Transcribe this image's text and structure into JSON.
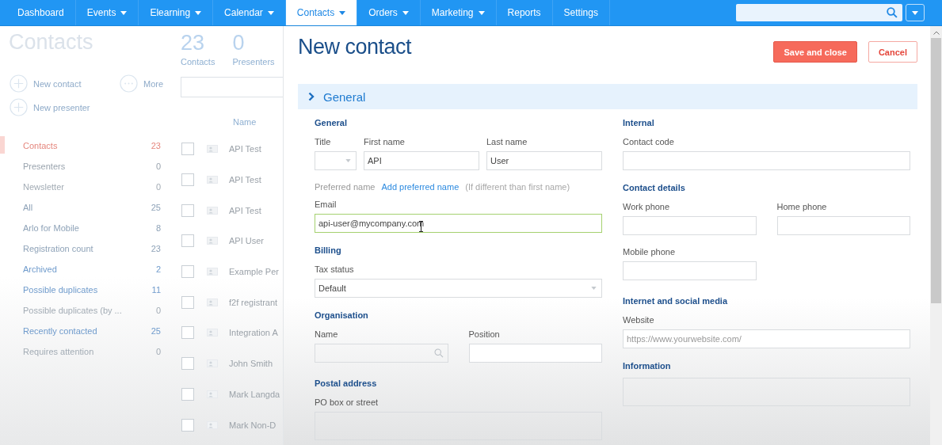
{
  "nav": {
    "items": [
      {
        "label": "Dashboard",
        "dropdown": false,
        "selected": false
      },
      {
        "label": "Events",
        "dropdown": true,
        "selected": false
      },
      {
        "label": "Elearning",
        "dropdown": true,
        "selected": false
      },
      {
        "label": "Calendar",
        "dropdown": true,
        "selected": false
      },
      {
        "label": "Contacts",
        "dropdown": true,
        "selected": true
      },
      {
        "label": "Orders",
        "dropdown": true,
        "selected": false
      },
      {
        "label": "Marketing",
        "dropdown": true,
        "selected": false
      },
      {
        "label": "Reports",
        "dropdown": false,
        "selected": false
      },
      {
        "label": "Settings",
        "dropdown": false,
        "selected": false
      }
    ]
  },
  "background": {
    "title": "Contacts",
    "stats": [
      {
        "value": "23",
        "label": "Contacts"
      },
      {
        "value": "0",
        "label": "Presenters"
      }
    ],
    "actions": [
      {
        "kind": "add",
        "label": "New contact"
      },
      {
        "kind": "more",
        "label": "More"
      },
      {
        "kind": "add",
        "label": "New presenter"
      }
    ],
    "filters": [
      {
        "label": "Contacts",
        "count": "23",
        "selected": true,
        "color": "#e5877e"
      },
      {
        "label": "Presenters",
        "count": "0",
        "selected": false,
        "color": "#9aa4ae"
      },
      {
        "label": "Newsletter",
        "count": "0",
        "selected": false,
        "color": "#a3acb5"
      },
      {
        "label": "All",
        "count": "25",
        "selected": false,
        "color": "#8fa3b8"
      },
      {
        "label": "Arlo for Mobile",
        "count": "8",
        "selected": false,
        "color": "#8fa3b8"
      },
      {
        "label": "Registration count",
        "count": "23",
        "selected": false,
        "color": "#8fa3b8"
      },
      {
        "label": "Archived",
        "count": "2",
        "selected": false,
        "color": "#6f9bcc"
      },
      {
        "label": "Possible duplicates",
        "count": "11",
        "selected": false,
        "color": "#6f9bcc"
      },
      {
        "label": "Possible duplicates (by ...",
        "count": "0",
        "selected": false,
        "color": "#a3acb5"
      },
      {
        "label": "Recently contacted",
        "count": "25",
        "selected": false,
        "color": "#6f9bcc"
      },
      {
        "label": "Requires attention",
        "count": "0",
        "selected": false,
        "color": "#a3acb5"
      }
    ],
    "table": {
      "columns": [
        "Name"
      ],
      "rows": [
        {
          "name": "API Test",
          "checked": false
        },
        {
          "name": "API Test",
          "checked": false
        },
        {
          "name": "API Test",
          "checked": false
        },
        {
          "name": "API User",
          "checked": false
        },
        {
          "name": "Example Per",
          "checked": false
        },
        {
          "name": "f2f registrant",
          "checked": false
        },
        {
          "name": "Integration A",
          "checked": false
        },
        {
          "name": "John Smith",
          "checked": false
        },
        {
          "name": "Mark Langda",
          "checked": false
        },
        {
          "name": "Mark Non-D",
          "checked": false
        }
      ]
    }
  },
  "panel": {
    "title": "New contact",
    "buttons": [
      {
        "label": "Save and close",
        "kind": "primary"
      },
      {
        "label": "Cancel",
        "kind": "secondary"
      }
    ],
    "section": {
      "title": "General"
    },
    "columns": [
      {
        "groups": [
          {
            "heading": "General",
            "blocks": [
              {
                "kind": "trio",
                "fields": [
                  {
                    "kind": "select",
                    "label": "Title",
                    "focused": false
                  },
                  {
                    "kind": "text",
                    "label": "First name",
                    "value": "API",
                    "focused": false
                  },
                  {
                    "kind": "text",
                    "label": "Last name",
                    "value": "User",
                    "focused": false
                  }
                ]
              },
              {
                "kind": "stack",
                "fields": [
                  {
                    "kind": "note",
                    "label": "Preferred name",
                    "link": "Add preferred name",
                    "hint": "(If different than first name)"
                  }
                ]
              },
              {
                "kind": "stack",
                "fields": [
                  {
                    "kind": "text",
                    "label": "Email",
                    "value": "api-user@mycompany.com",
                    "focused": true
                  }
                ]
              }
            ]
          },
          {
            "heading": "Billing",
            "blocks": [
              {
                "kind": "stack",
                "fields": [
                  {
                    "kind": "select",
                    "label": "Tax status",
                    "value": "Default",
                    "focused": false
                  }
                ]
              }
            ]
          },
          {
            "heading": "Organisation",
            "blocks": [
              {
                "kind": "pair",
                "fields": [
                  {
                    "kind": "search",
                    "label": "Name",
                    "focused": false
                  },
                  {
                    "kind": "text",
                    "label": "Position",
                    "focused": false
                  }
                ]
              }
            ]
          },
          {
            "heading": "Postal address",
            "blocks": [
              {
                "kind": "stack",
                "fields": [
                  {
                    "kind": "textarea",
                    "label": "PO box or street",
                    "focused": false
                  }
                ]
              }
            ]
          }
        ]
      },
      {
        "groups": [
          {
            "heading": "Internal",
            "blocks": [
              {
                "kind": "stack",
                "fields": [
                  {
                    "kind": "text",
                    "label": "Contact code",
                    "focused": false
                  }
                ]
              }
            ]
          },
          {
            "heading": "Contact details",
            "blocks": [
              {
                "kind": "pair",
                "fields": [
                  {
                    "kind": "text",
                    "label": "Work phone",
                    "focused": false
                  },
                  {
                    "kind": "text",
                    "label": "Home phone",
                    "focused": false
                  },
                  {
                    "kind": "text",
                    "label": "Mobile phone",
                    "focused": false
                  }
                ]
              }
            ]
          },
          {
            "heading": "Internet and social media",
            "blocks": [
              {
                "kind": "stack",
                "fields": [
                  {
                    "kind": "text",
                    "label": "Website",
                    "placeholder": "https://www.yourwebsite.com/",
                    "focused": false
                  }
                ]
              }
            ]
          },
          {
            "heading": "Information",
            "blocks": [
              {
                "kind": "stack",
                "fields": [
                  {
                    "kind": "textarea",
                    "focused": false
                  }
                ]
              }
            ]
          }
        ]
      }
    ]
  }
}
